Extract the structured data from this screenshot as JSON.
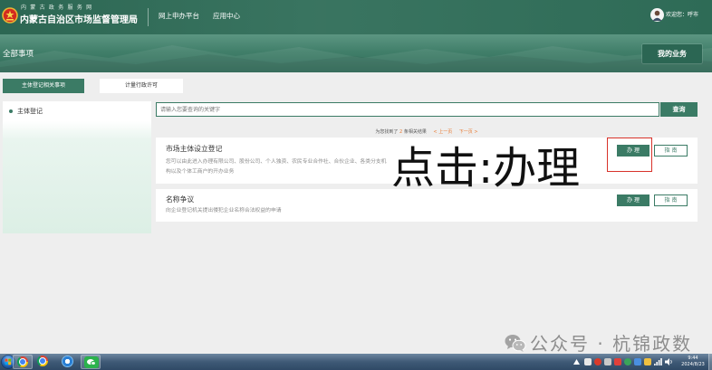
{
  "header": {
    "site_name": "内 蒙 古 政 务 服 务 网",
    "org_name": "内蒙古自治区市场监督管理局",
    "nav": [
      {
        "label": "网上申办平台"
      },
      {
        "label": "应用中心"
      }
    ],
    "welcome": "欢迎您：呼市",
    "emblem_icon": "national-emblem-icon",
    "avatar_icon": "user-avatar-icon"
  },
  "banner": {
    "title": "全部事项",
    "my_business": "我的业务"
  },
  "tabs": [
    {
      "label": "主体登记相关事项",
      "active": true
    },
    {
      "label": "计量行政许可",
      "active": false
    }
  ],
  "sidebar": {
    "items": [
      {
        "label": "主体登记",
        "icon": "bullet-dot-icon"
      }
    ]
  },
  "search": {
    "placeholder": "请输入您要查询的关键字",
    "value": "",
    "button": "查询"
  },
  "results": {
    "prefix": "为您找到了",
    "count": 2,
    "suffix": "条相关结果",
    "prev": "< 上一页",
    "next": "下一页 >"
  },
  "items": [
    {
      "title": "市场主体设立登记",
      "desc": [
        "您可以由此进入办理有限公司、股份公司、个人独资、农民专业合作社、合伙企业、各类分支机",
        "构以及个体工商户的开办业务"
      ],
      "handle": "办 理",
      "guide": "指 南"
    },
    {
      "title": "名称争议",
      "desc": [
        "向企业登记机关提出侵犯企业名称合法权益的申请"
      ],
      "handle": "办 理",
      "guide": "指 南"
    }
  ],
  "annotation": {
    "text": "点击:办理"
  },
  "watermark": {
    "text": "公众号 · 杭锦政数",
    "icon": "wechat-icon"
  },
  "taskbar": {
    "apps": [
      "start-orb-icon",
      "chrome-icon",
      "chrome-icon",
      "app-icon",
      "wechat-icon"
    ],
    "time": "9:44",
    "date": "2024/8/23"
  },
  "theme": {
    "primary": "#3b7b65",
    "header_bg": "#2f6d58",
    "accent": "#e8772e",
    "annotation_red": "#d8322a"
  }
}
